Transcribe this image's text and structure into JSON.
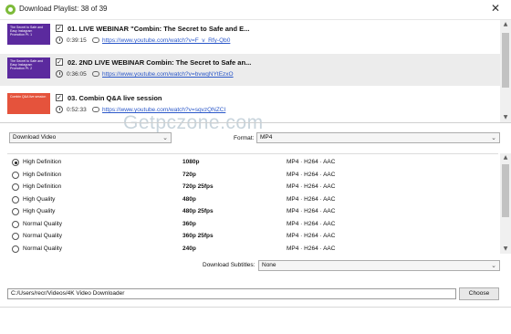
{
  "window": {
    "title": "Download Playlist: 38 of 39",
    "close_glyph": "✕"
  },
  "playlist": {
    "items": [
      {
        "index_title": "01. LIVE WEBINAR \"Combin: The Secret to Safe and E...",
        "duration": "0:39:15",
        "url": "https://www.youtube.com/watch?v=F_v_Rfy-Qb0",
        "thumb_text": "The Secret to Safe and Easy Instagram Promotion Pt. 1",
        "thumb_color": "#5b2a9e",
        "checked": "✓"
      },
      {
        "index_title": "02. 2ND LIVE WEBINAR Combin: The Secret to Safe an...",
        "duration": "0:36:05",
        "url": "https://www.youtube.com/watch?v=bvwqNYtEzxO",
        "thumb_text": "The Secret to Safe and Easy Instagram Promotion Pt. 2",
        "thumb_color": "#5b2a9e",
        "checked": "✓"
      },
      {
        "index_title": "03. Combin Q&A live session",
        "duration": "0:52:33",
        "url": "https://www.youtube.com/watch?v=sqvzQNZCI",
        "thumb_text": "Combin Q&A live session",
        "thumb_color": "#e5533c",
        "checked": "✓"
      }
    ]
  },
  "watermark": "Getpczone.com",
  "options": {
    "mode_value": "Download Video",
    "format_label": "Format:",
    "format_value": "MP4"
  },
  "qualities": [
    {
      "name": "High Definition",
      "resolution": "1080p",
      "codec": "MP4 · H264 · AAC",
      "selected": true
    },
    {
      "name": "High Definition",
      "resolution": "720p",
      "codec": "MP4 · H264 · AAC",
      "selected": false
    },
    {
      "name": "High Definition",
      "resolution": "720p 25fps",
      "codec": "MP4 · H264 · AAC",
      "selected": false
    },
    {
      "name": "High Quality",
      "resolution": "480p",
      "codec": "MP4 · H264 · AAC",
      "selected": false
    },
    {
      "name": "High Quality",
      "resolution": "480p 25fps",
      "codec": "MP4 · H264 · AAC",
      "selected": false
    },
    {
      "name": "Normal Quality",
      "resolution": "360p",
      "codec": "MP4 · H264 · AAC",
      "selected": false
    },
    {
      "name": "Normal Quality",
      "resolution": "360p 25fps",
      "codec": "MP4 · H264 · AAC",
      "selected": false
    },
    {
      "name": "Normal Quality",
      "resolution": "240p",
      "codec": "MP4 · H264 · AAC",
      "selected": false
    }
  ],
  "subtitles": {
    "label": "Download Subtitles:",
    "value": "None"
  },
  "save_path": {
    "value": "C:/Users/recr/Videos/4K Video Downloader",
    "choose_label": "Choose"
  },
  "glyphs": {
    "chevron_down": "⌄",
    "scroll_up": "▲",
    "scroll_down": "▼"
  }
}
